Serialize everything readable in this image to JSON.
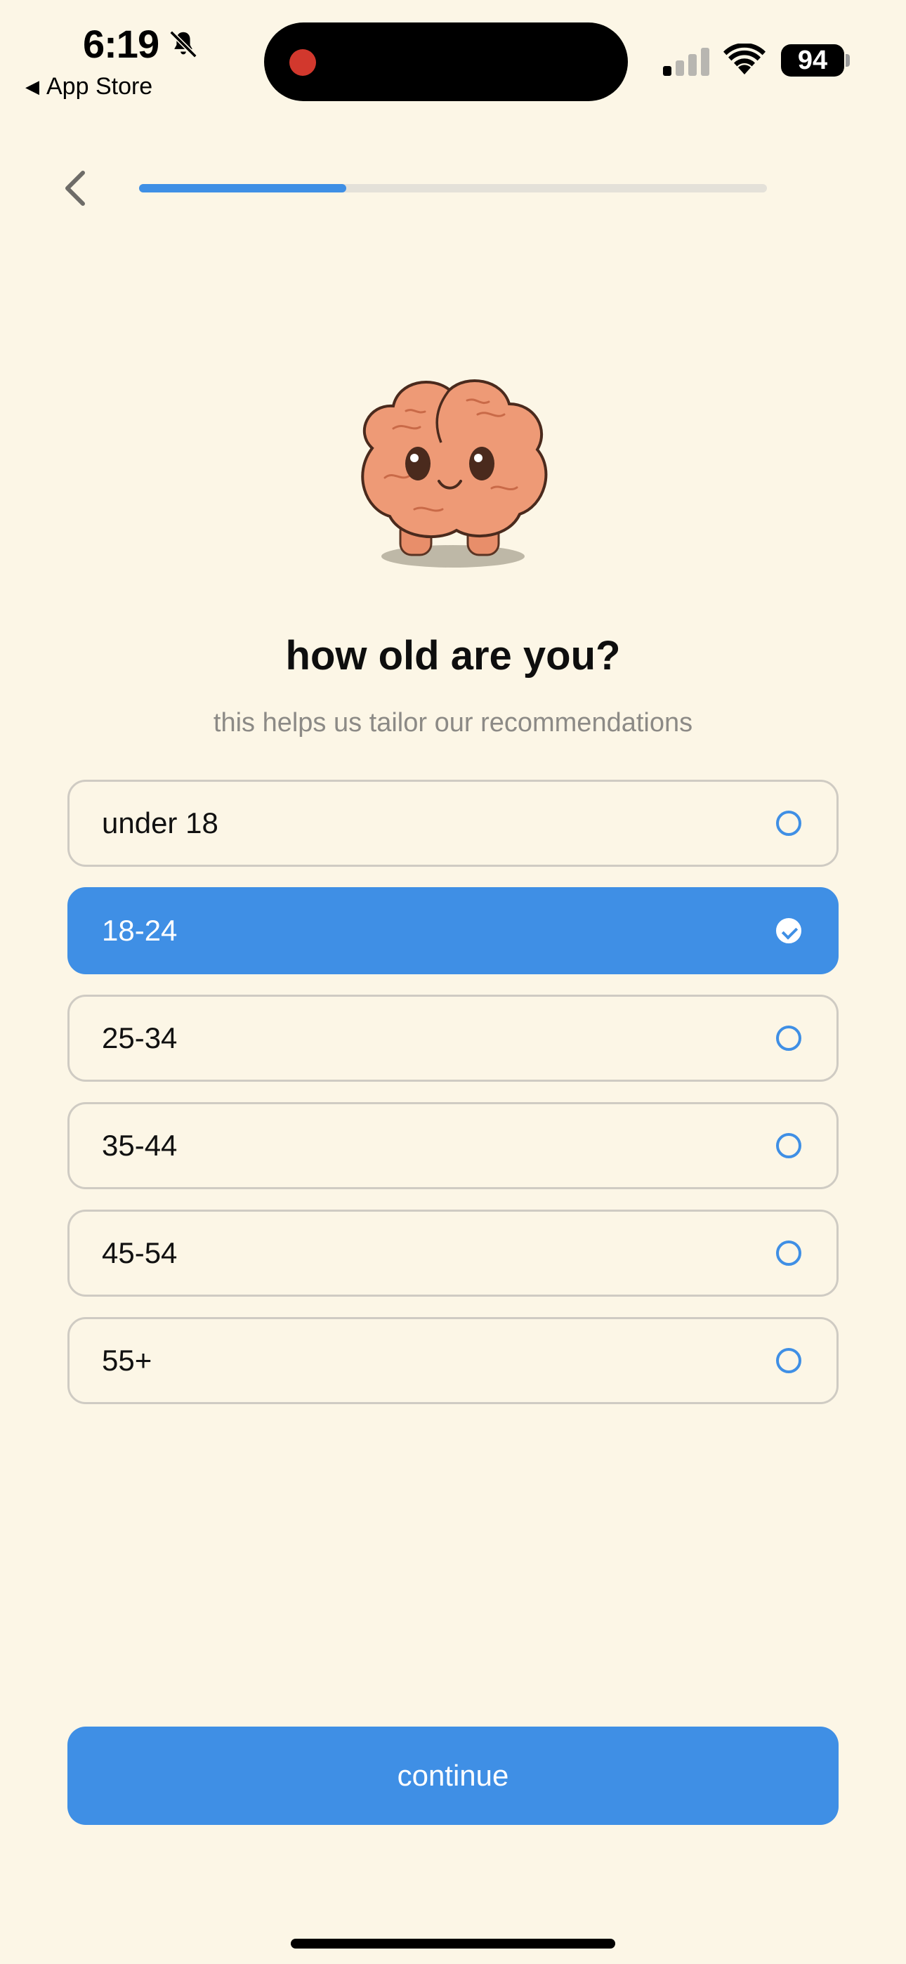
{
  "status_bar": {
    "time": "6:19",
    "back_app": "App Store",
    "battery": "94",
    "icons": [
      "bell-slash-icon",
      "signal-icon",
      "wifi-icon",
      "battery-icon"
    ]
  },
  "header": {
    "back_icon": "chevron-left-icon",
    "progress_fraction": 0.33
  },
  "mascot_icon": "brain-mascot",
  "question": {
    "title": "how old are you?",
    "subtitle": "this helps us tailor our recommendations"
  },
  "options": [
    {
      "label": "under 18",
      "selected": false
    },
    {
      "label": "18-24",
      "selected": true
    },
    {
      "label": "25-34",
      "selected": false
    },
    {
      "label": "35-44",
      "selected": false
    },
    {
      "label": "45-54",
      "selected": false
    },
    {
      "label": "55+",
      "selected": false
    }
  ],
  "continue_label": "continue",
  "colors": {
    "background": "#FCF6E6",
    "accent": "#3F8FE5",
    "border": "#CFCBC3",
    "subtitle": "#8C8A86"
  }
}
